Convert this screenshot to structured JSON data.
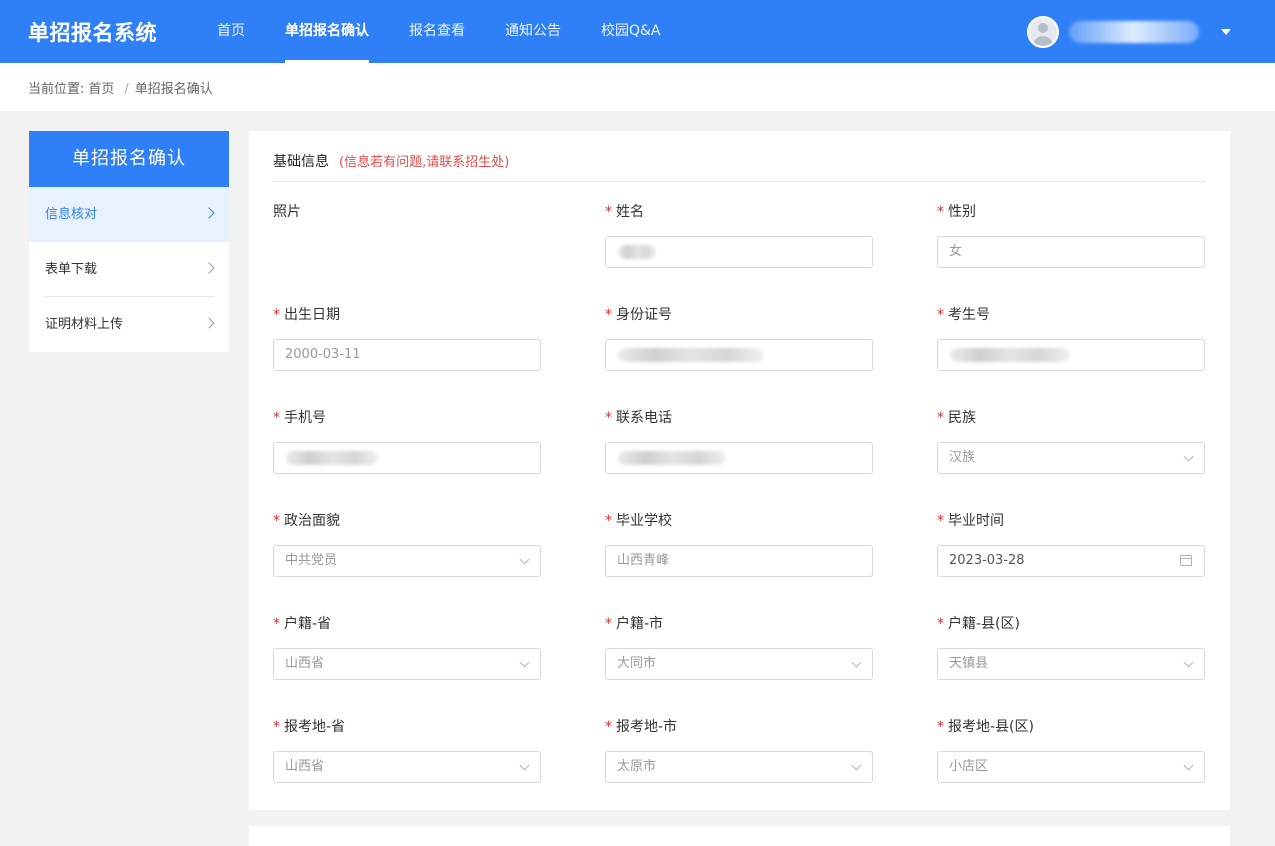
{
  "header": {
    "brand": "单招报名系统",
    "nav": [
      {
        "label": "首页",
        "active": false
      },
      {
        "label": "单招报名确认",
        "active": true
      },
      {
        "label": "报名查看",
        "active": false
      },
      {
        "label": "通知公告",
        "active": false
      },
      {
        "label": "校园Q&A",
        "active": false
      }
    ],
    "user_dropdown_icon": "chevron-down-icon"
  },
  "breadcrumb": {
    "prefix": "当前位置:",
    "items": [
      "首页",
      "单招报名确认"
    ],
    "separator": "/"
  },
  "sidebar": {
    "title": "单招报名确认",
    "items": [
      {
        "label": "信息核对",
        "active": true
      },
      {
        "label": "表单下载",
        "active": false
      },
      {
        "label": "证明材料上传",
        "active": false
      }
    ]
  },
  "form": {
    "section_title": "基础信息",
    "section_note": "(信息若有问题,请联系招生处)",
    "photo_label": "照片",
    "fields": {
      "name": {
        "label": "姓名",
        "value": ""
      },
      "gender": {
        "label": "性别",
        "value": "女"
      },
      "birth": {
        "label": "出生日期",
        "value": "2000-03-11"
      },
      "id_number": {
        "label": "身份证号",
        "value": ""
      },
      "exam_no": {
        "label": "考生号",
        "value": ""
      },
      "mobile": {
        "label": "手机号",
        "value": ""
      },
      "contact": {
        "label": "联系电话",
        "value": ""
      },
      "ethnicity": {
        "label": "民族",
        "value": "汉族"
      },
      "politics": {
        "label": "政治面貌",
        "value": "中共党员"
      },
      "school": {
        "label": "毕业学校",
        "value": "山西青峰"
      },
      "grad_date": {
        "label": "毕业时间",
        "value": "2023-03-28"
      },
      "huji_prov": {
        "label": "户籍-省",
        "value": "山西省"
      },
      "huji_city": {
        "label": "户籍-市",
        "value": "大同市"
      },
      "huji_county": {
        "label": "户籍-县(区)",
        "value": "天镇县"
      },
      "exam_prov": {
        "label": "报考地-省",
        "value": "山西省"
      },
      "exam_city": {
        "label": "报考地-市",
        "value": "太原市"
      },
      "exam_county": {
        "label": "报考地-县(区)",
        "value": "小店区"
      }
    }
  },
  "colors": {
    "primary": "#2f80f7",
    "required": "#e02e2e",
    "note": "#e24b4b",
    "background": "#f2f2f2"
  }
}
